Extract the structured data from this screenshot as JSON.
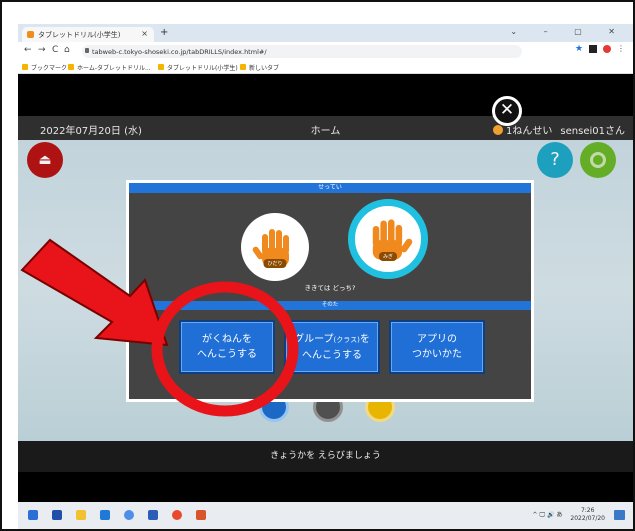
{
  "browser": {
    "tab_title": "タブレットドリル(小学生)",
    "tab_close": "×",
    "new_tab": "+",
    "window_controls": "⌄ – ▢ ✕",
    "url": "tabweb-c.tokyo-shoseki.co.jp/tabDRILLS/index.html#/",
    "nav_back": "←",
    "nav_forward": "→",
    "nav_reload": "C",
    "nav_home": "⌂",
    "bookmarks": [
      "ブックマーク",
      "ホーム-タブレットドリル...",
      "タブレットドリル(小学生)",
      "新しいタブ"
    ]
  },
  "app": {
    "date": "2022年07月20日 (水)",
    "title": "ホーム",
    "grade": "1ねんせい",
    "user": "sensei01さん",
    "exit_symbol": "⏏",
    "help_symbol": "?",
    "bottom_message": "きょうかを えらびましょう"
  },
  "modal": {
    "header": "せってい",
    "left_hand_label": "ひだり",
    "right_hand_label": "みぎ",
    "question": "ききては どっち?",
    "section_label": "そのた",
    "close_symbol": "✕",
    "options": [
      {
        "line1": "がくねんを",
        "line2": "へんこうする"
      },
      {
        "line1a": "グループ",
        "line1b": "(クラス)",
        "line1c": "を",
        "line2": "へんこうする"
      },
      {
        "line1": "アプリの",
        "line2": "つかいかた"
      }
    ]
  },
  "taskbar": {
    "time": "7:26",
    "date": "2022/07/20",
    "tray_symbols": "^ 🖵 🔊 あ"
  },
  "colors": {
    "accent_blue": "#2274d8",
    "annotation_red": "#e8141a",
    "hand_orange": "#f08a1e",
    "selected_ring": "#20c0e0"
  }
}
